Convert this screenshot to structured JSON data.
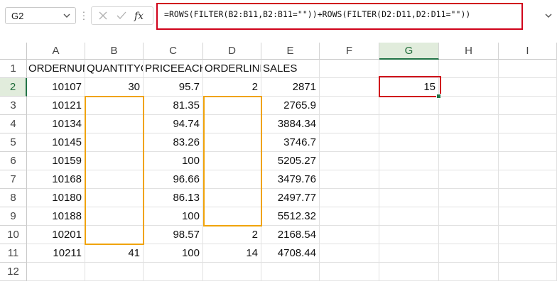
{
  "name_box": {
    "value": "G2"
  },
  "formula_bar": {
    "formula": "=ROWS(FILTER(B2:B11,B2:B11=\"\"))+ROWS(FILTER(D2:D11,D2:D11=\"\"))",
    "fx_label": "fx"
  },
  "columns": [
    "A",
    "B",
    "C",
    "D",
    "E",
    "F",
    "G",
    "H",
    "I"
  ],
  "selected_column": "G",
  "selected_row": 2,
  "rows": [
    1,
    2,
    3,
    4,
    5,
    6,
    7,
    8,
    9,
    10,
    11,
    12
  ],
  "sheet": [
    [
      "ORDERNUMBER",
      "QUANTITYORDERED",
      "PRICEEACH",
      "ORDERLINENUMBER",
      "SALES",
      "",
      "",
      "",
      ""
    ],
    [
      "10107",
      "30",
      "95.7",
      "2",
      "2871",
      "",
      "15",
      "",
      ""
    ],
    [
      "10121",
      "",
      "81.35",
      "",
      "2765.9",
      "",
      "",
      "",
      ""
    ],
    [
      "10134",
      "",
      "94.74",
      "",
      "3884.34",
      "",
      "",
      "",
      ""
    ],
    [
      "10145",
      "",
      "83.26",
      "",
      "3746.7",
      "",
      "",
      "",
      ""
    ],
    [
      "10159",
      "",
      "100",
      "",
      "5205.27",
      "",
      "",
      "",
      ""
    ],
    [
      "10168",
      "",
      "96.66",
      "",
      "3479.76",
      "",
      "",
      "",
      ""
    ],
    [
      "10180",
      "",
      "86.13",
      "",
      "2497.77",
      "",
      "",
      "",
      ""
    ],
    [
      "10188",
      "",
      "100",
      "",
      "5512.32",
      "",
      "",
      "",
      ""
    ],
    [
      "10201",
      "",
      "98.57",
      "2",
      "2168.54",
      "",
      "",
      "",
      ""
    ],
    [
      "10211",
      "41",
      "100",
      "14",
      "4708.44",
      "",
      "",
      "",
      ""
    ],
    [
      "",
      "",
      "",
      "",
      "",
      "",
      "",
      "",
      ""
    ]
  ],
  "highlight_colors": {
    "orange": "#f0a30a",
    "red": "#d0021b",
    "selection_green": "#217346"
  }
}
